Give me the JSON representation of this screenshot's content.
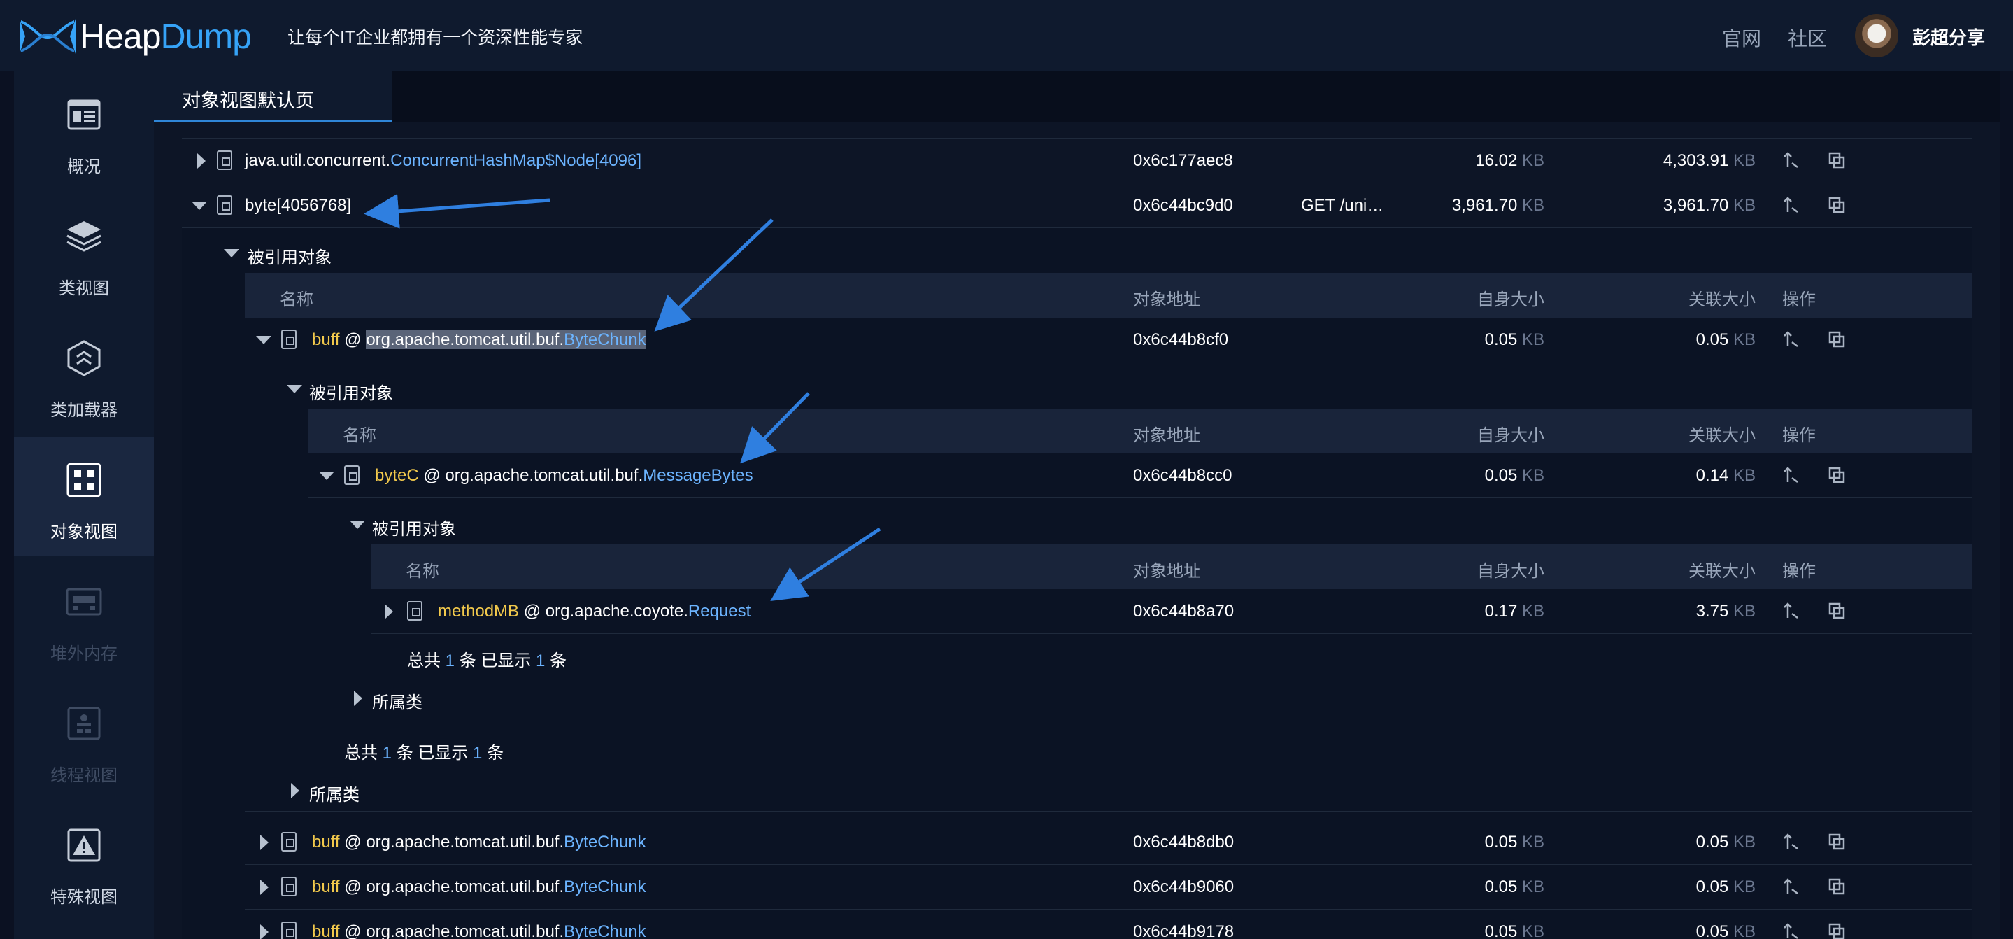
{
  "header": {
    "brand_part1": "Heap",
    "brand_part2": "Dump",
    "slogan": "让每个IT企业都拥有一个资深性能专家",
    "nav_official": "官网",
    "nav_community": "社区",
    "username": "彭超分享"
  },
  "sidebar": {
    "items": [
      {
        "label": "概况",
        "icon": "overview-icon"
      },
      {
        "label": "类视图",
        "icon": "layers-icon"
      },
      {
        "label": "类加载器",
        "icon": "classloader-icon"
      },
      {
        "label": "对象视图",
        "icon": "grid-icon"
      },
      {
        "label": "堆外内存",
        "icon": "offheap-icon"
      },
      {
        "label": "线程视图",
        "icon": "thread-icon"
      },
      {
        "label": "特殊视图",
        "icon": "warning-icon"
      }
    ]
  },
  "tab": {
    "label": "对象视图默认页"
  },
  "table": {
    "columns": {
      "name": "名称",
      "address": "对象地址",
      "self": "自身大小",
      "retained": "关联大小",
      "ops": "操作"
    },
    "unit": "KB",
    "rows": {
      "concurrent_prefix": "java.util.concurrent.",
      "concurrent_class": "ConcurrentHashMap$Node[4096]",
      "concurrent_addr": "0x6c177aec8",
      "concurrent_self": "16.02",
      "concurrent_ret": "4,303.91",
      "byte_name": "byte[4056768]",
      "byte_addr": "0x6c44bc9d0",
      "byte_extra": "GET /uni…",
      "byte_self": "3,961.70",
      "byte_ret": "3,961.70"
    },
    "referenced_label": "被引用对象",
    "class_label": "所属类",
    "level1": {
      "field": "buff",
      "at": " @ ",
      "pkg": "org.apache.tomcat.util.buf.",
      "cls": "ByteChunk",
      "addr": "0x6c44b8cf0",
      "self": "0.05",
      "ret": "0.05"
    },
    "level2": {
      "field": "byteC",
      "at": " @ ",
      "pkg": "org.apache.tomcat.util.buf.",
      "cls": "MessageBytes",
      "addr": "0x6c44b8cc0",
      "self": "0.05",
      "ret": "0.14"
    },
    "level3": {
      "field": "methodMB",
      "at": " @ ",
      "pkg": "org.apache.coyote.",
      "cls": "Request",
      "addr": "0x6c44b8a70",
      "self": "0.17",
      "ret": "3.75"
    },
    "summary": {
      "prefix": "总共 ",
      "count": "1",
      "mid": " 条  已显示 ",
      "shown": "1",
      "suffix": " 条"
    },
    "siblings": [
      {
        "field": "buff",
        "at": " @ ",
        "pkg": "org.apache.tomcat.util.buf.",
        "cls": "ByteChunk",
        "addr": "0x6c44b8db0",
        "self": "0.05",
        "ret": "0.05"
      },
      {
        "field": "buff",
        "at": " @ ",
        "pkg": "org.apache.tomcat.util.buf.",
        "cls": "ByteChunk",
        "addr": "0x6c44b9060",
        "self": "0.05",
        "ret": "0.05"
      },
      {
        "field": "buff",
        "at": " @ ",
        "pkg": "org.apache.tomcat.util.buf.",
        "cls": "ByteChunk",
        "addr": "0x6c44b9178",
        "self": "0.05",
        "ret": "0.05"
      }
    ]
  },
  "colors": {
    "accent": "#36a3f7",
    "link": "#6cb4ff",
    "field": "#f2c94c",
    "annotation_arrow": "#2f7fe0"
  }
}
